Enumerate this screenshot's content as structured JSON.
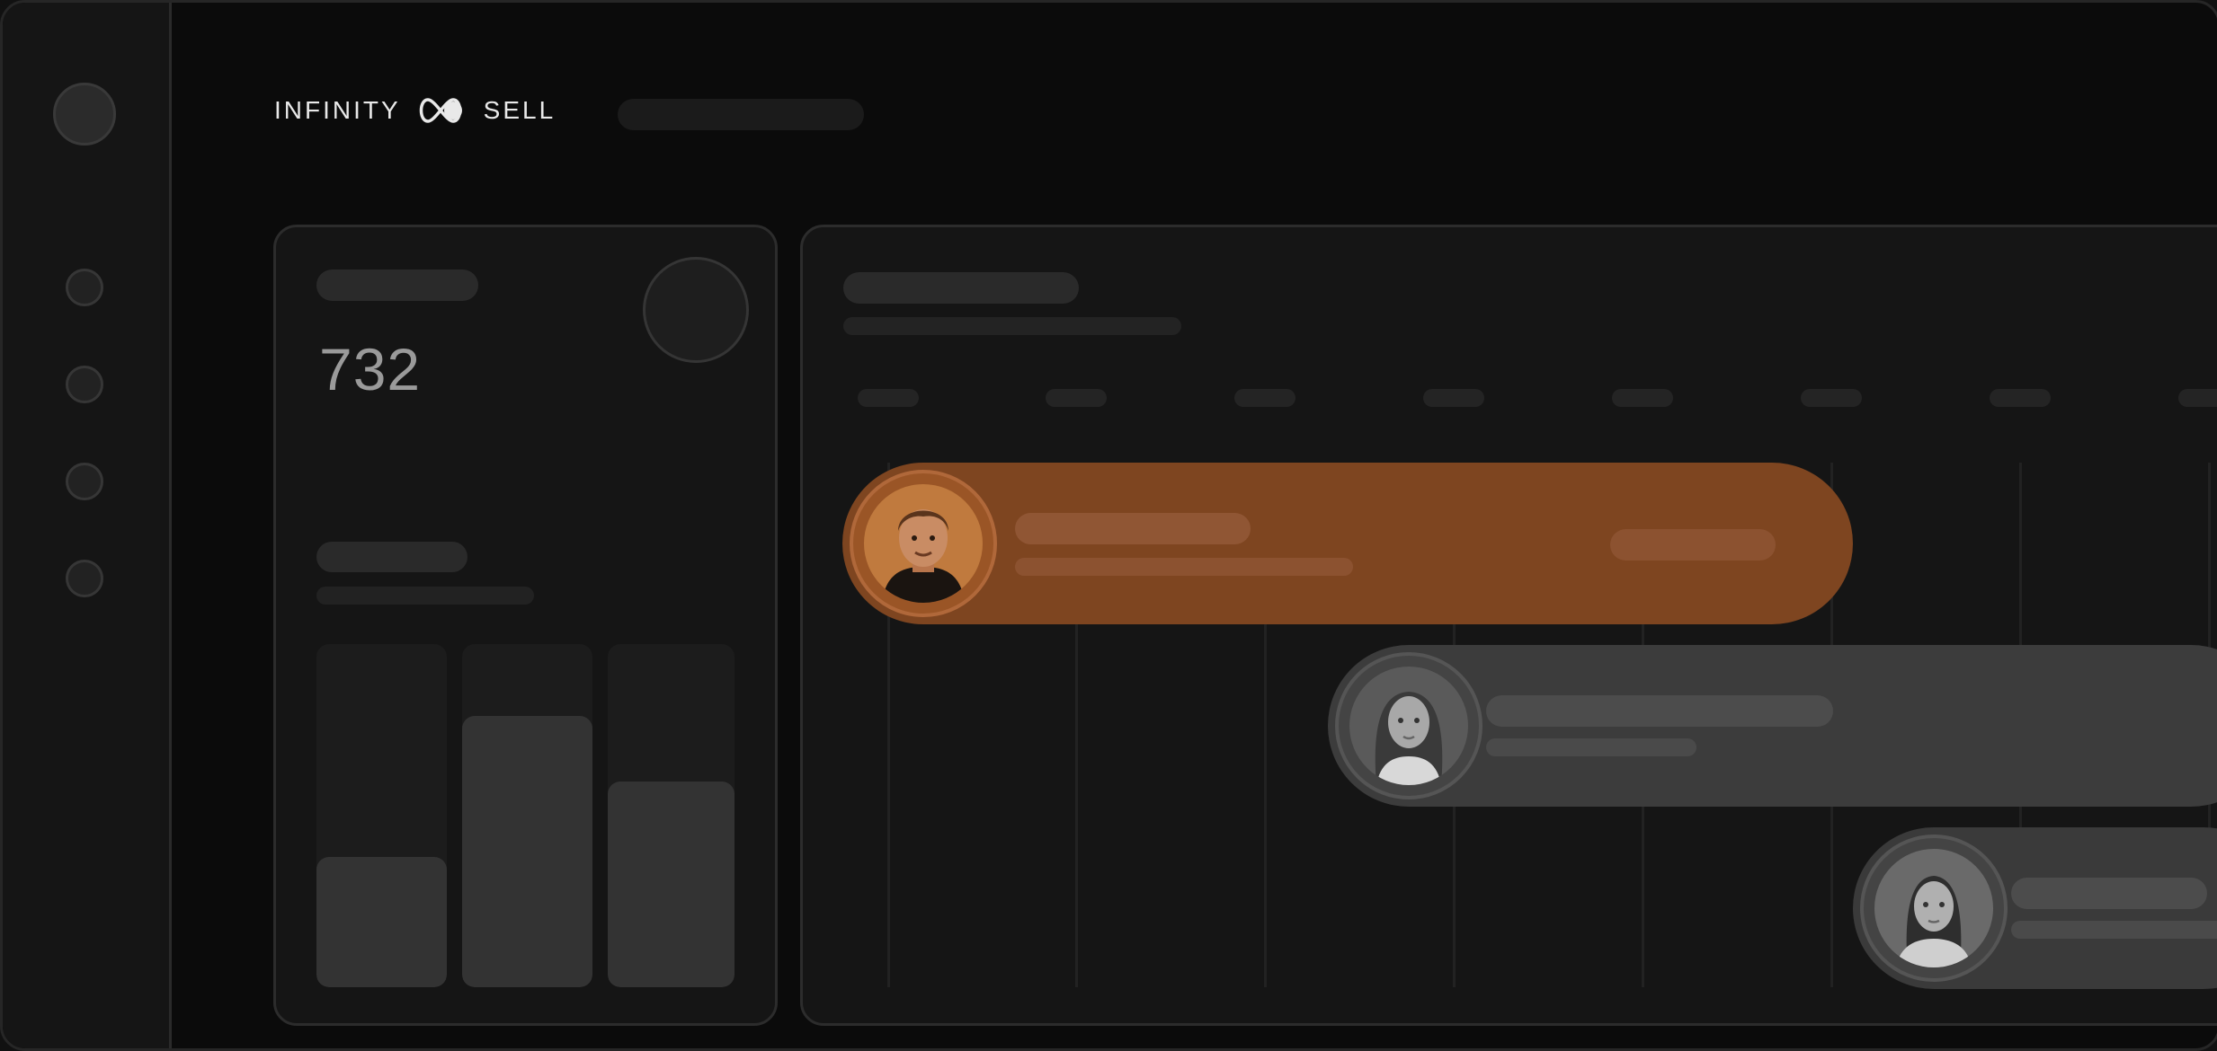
{
  "app": {
    "brand_left": "INFINITY",
    "brand_right": "SELL"
  },
  "stats_card": {
    "metric_value": "732",
    "bars": [
      0.38,
      0.79,
      0.6
    ]
  },
  "timeline": {
    "rows": [
      {
        "color": "#7e4520",
        "avatar": "person-male-avatar"
      },
      {
        "color": "#3c3c3c",
        "avatar": "person-female-avatar"
      },
      {
        "color": "#3a3a3a",
        "avatar": "person-female-avatar-2"
      }
    ]
  },
  "colors": {
    "accent": "#7e4520",
    "background": "#0b0b0b",
    "card": "#151515"
  }
}
